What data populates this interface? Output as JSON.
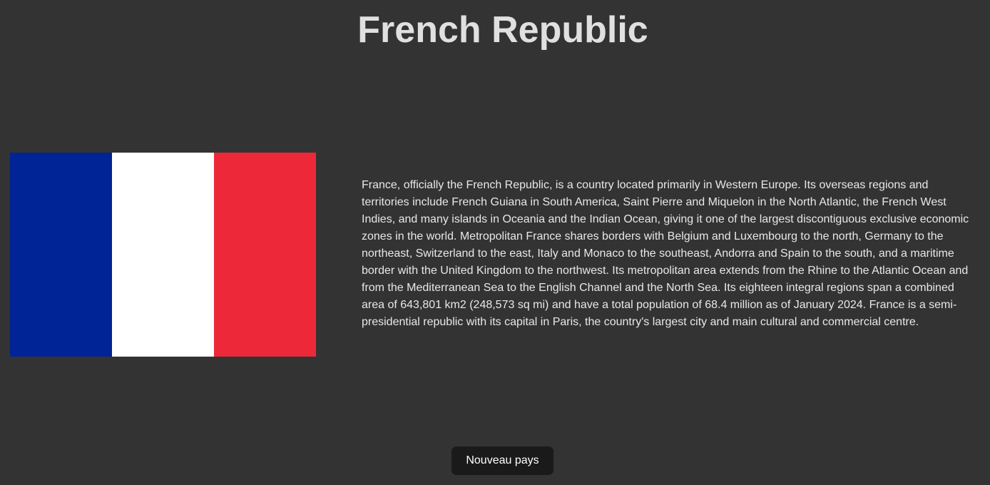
{
  "country": {
    "title": "French Republic",
    "description": "France, officially the French Republic, is a country located primarily in Western Europe. Its overseas regions and territories include French Guiana in South America, Saint Pierre and Miquelon in the North Atlantic, the French West Indies, and many islands in Oceania and the Indian Ocean, giving it one of the largest discontiguous exclusive economic zones in the world. Metropolitan France shares borders with Belgium and Luxembourg to the north, Germany to the northeast, Switzerland to the east, Italy and Monaco to the southeast, Andorra and Spain to the south, and a maritime border with the United Kingdom to the northwest. Its metropolitan area extends from the Rhine to the Atlantic Ocean and from the Mediterranean Sea to the English Channel and the North Sea. Its eighteen integral regions span a combined area of 643,801 km2 (248,573 sq mi) and have a total population of 68.4 million as of January 2024. France is a semi-presidential republic with its capital in Paris, the country's largest city and main cultural and commercial centre.",
    "flag": {
      "colors": [
        "#002395",
        "#ffffff",
        "#ed2939"
      ]
    }
  },
  "actions": {
    "new_country_label": "Nouveau pays"
  },
  "theme": {
    "background": "#333333",
    "button_background": "#1a1a1a"
  }
}
